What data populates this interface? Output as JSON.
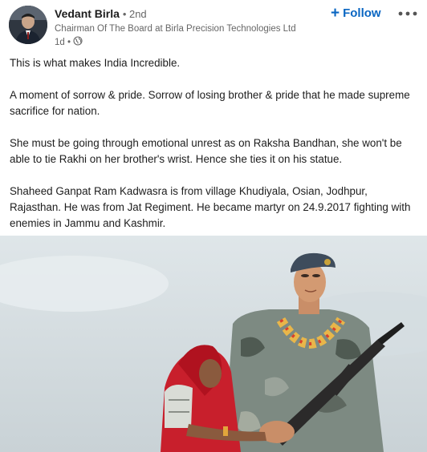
{
  "post": {
    "author": {
      "name": "Vedant Birla",
      "degree": "• 2nd",
      "headline": "Chairman Of The Board at Birla Precision Technologies Ltd",
      "time": "1d •"
    },
    "actions": {
      "follow_label": "Follow",
      "follow_icon": "plus-icon",
      "more_icon": "ellipsis-icon"
    },
    "body": {
      "p1": "This is what makes India Incredible.",
      "p2": "A moment of sorrow & pride. Sorrow of losing brother & pride that he made supreme sacrifice for nation.",
      "p3": "She must be going through emotional unrest as on Raksha Bandhan, she won't be able to tie Rakhi on her brother's wrist. Hence she ties it on his statue.",
      "p4": "Shaheed Ganpat Ram Kadwasra is from village Khudiyala, Osian, Jodhpur, Rajasthan. He was from Jat Regiment. He became martyr on 24.9.2017 fighting with enemies in Jammu and Kashmir."
    },
    "colors": {
      "link_blue": "#0a66c2",
      "secondary_text": "#666666"
    }
  }
}
